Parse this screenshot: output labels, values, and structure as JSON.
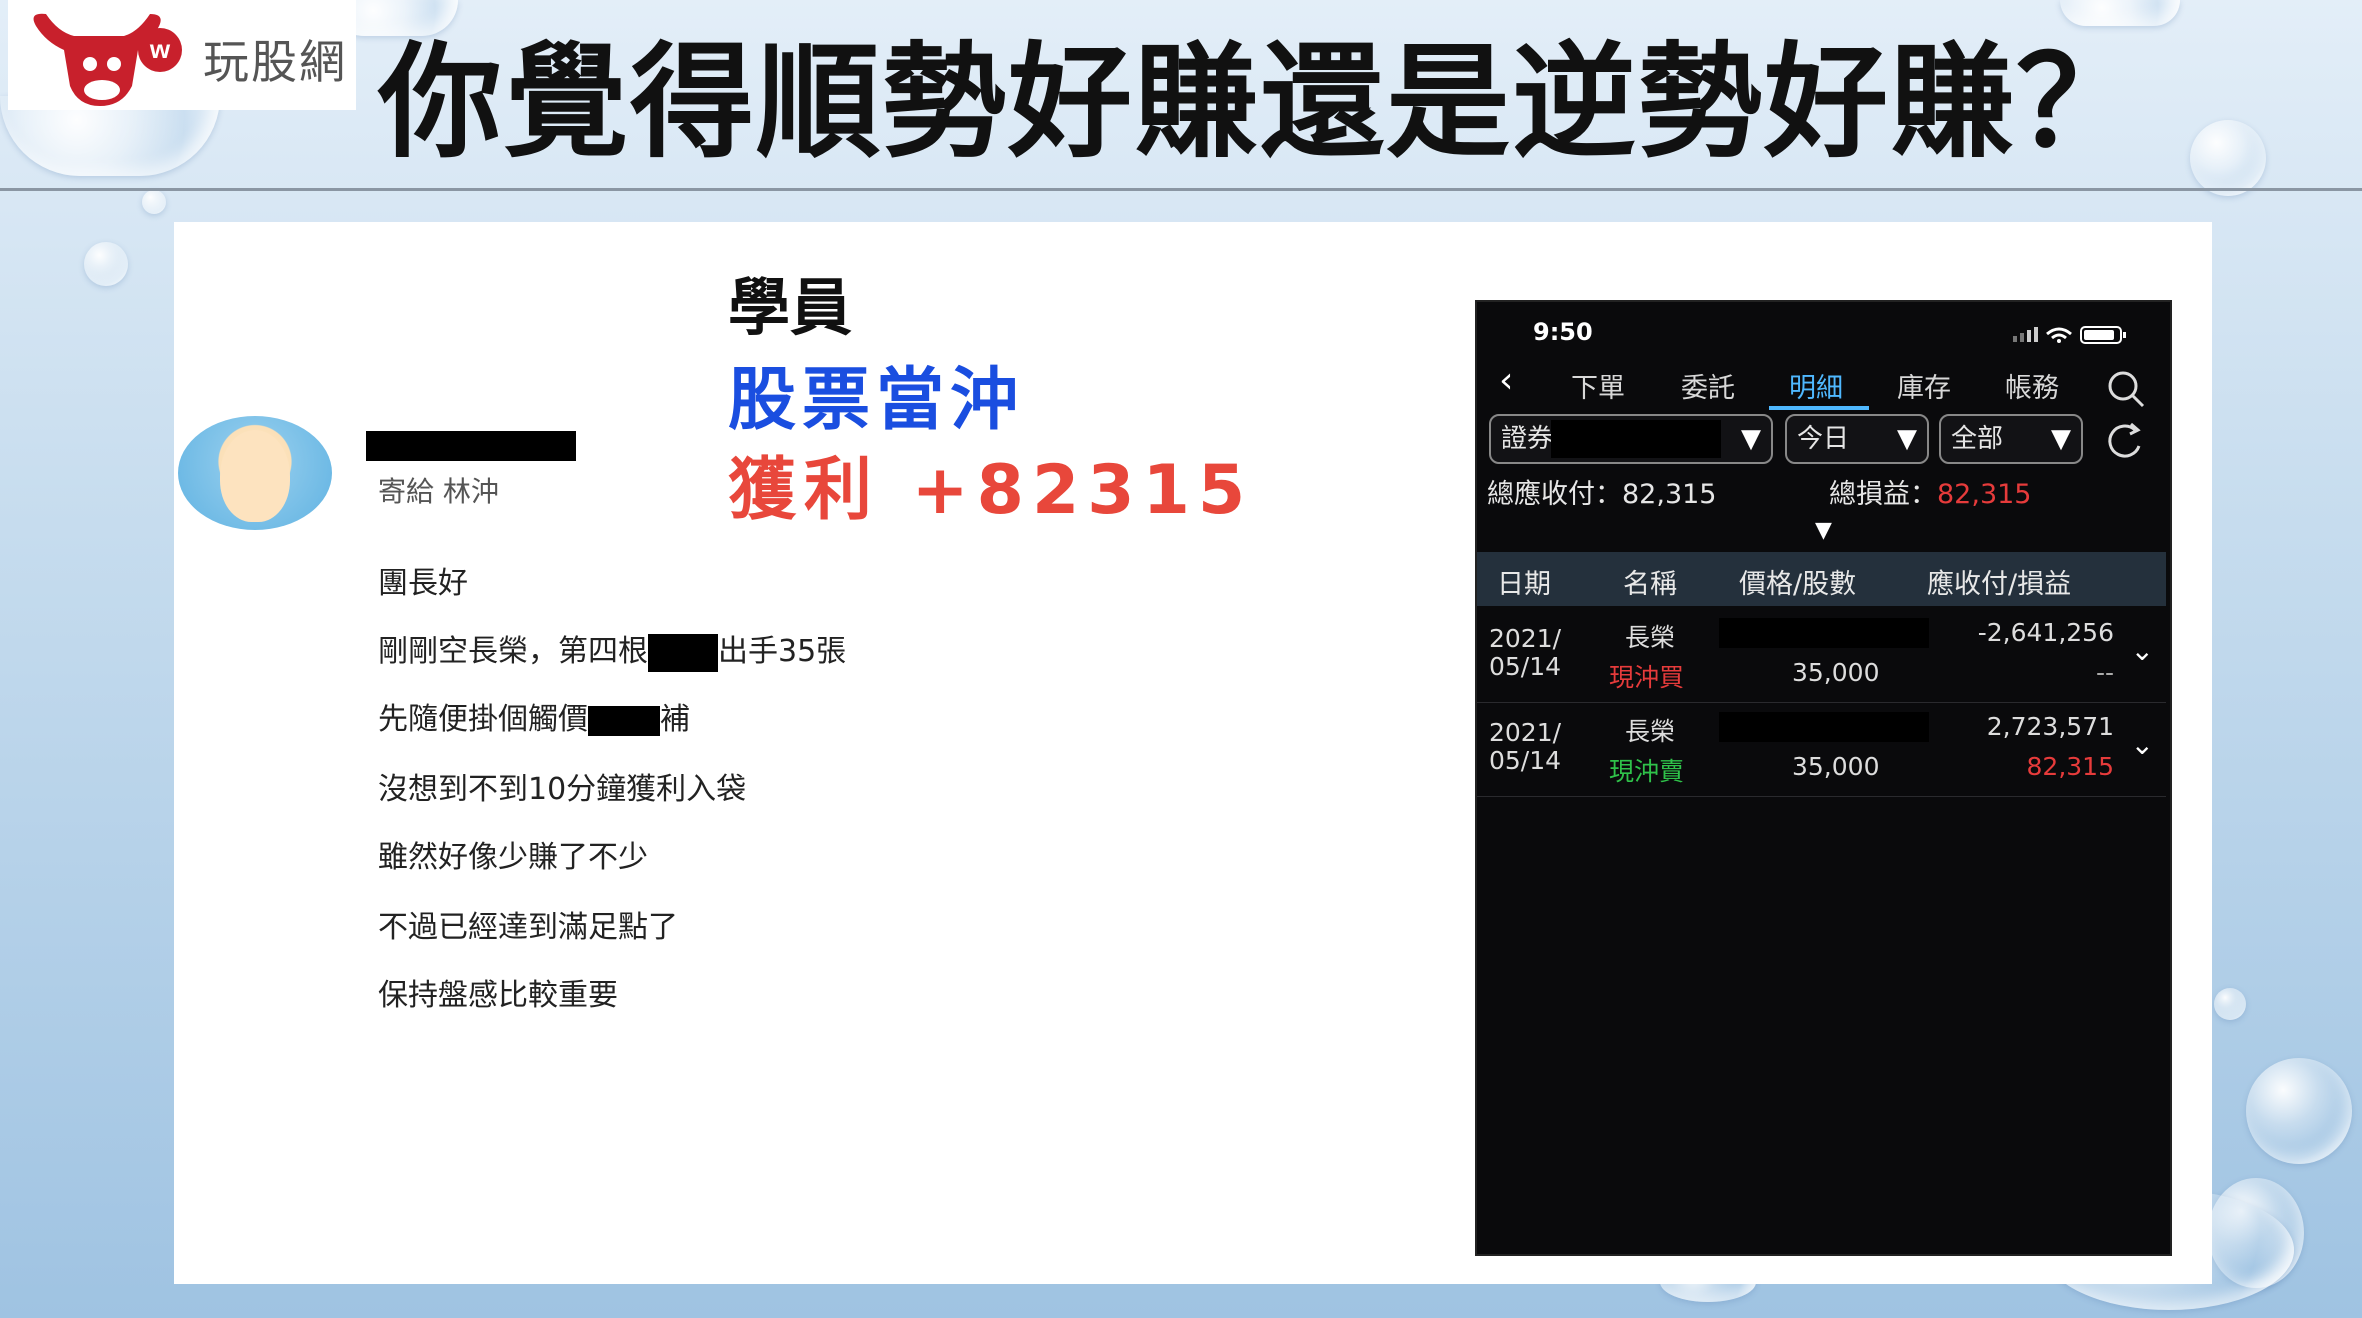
{
  "logo": {
    "brand": "玩股網",
    "mark": "w"
  },
  "title": "你覺得順勢好賺還是逆勢好賺？",
  "post": {
    "to_line": "寄給 林沖",
    "label1": "學員",
    "label2": "股票當沖",
    "label3": "獲利 +82315",
    "messages": {
      "m1": "團長好",
      "m2a": "剛剛空長榮，第四根",
      "m2b": "出手35張",
      "m3a": "先隨便掛個觸價",
      "m3b": "補",
      "m4": "沒想到不到10分鐘獲利入袋",
      "m5": "雖然好像少賺了不少",
      "m6": "不過已經達到滿足點了",
      "m7": "保持盤感比較重要"
    }
  },
  "phone": {
    "time": "9:50",
    "tabs": {
      "t1": "下單",
      "t2": "委託",
      "t3": "明細",
      "t4": "庫存",
      "t5": "帳務"
    },
    "filters": {
      "account": "證券",
      "period": "今日",
      "scope": "全部"
    },
    "summary": {
      "payable_label": "總應收付：",
      "payable_value": "82,315",
      "pnl_label": "總損益：",
      "pnl_value": "82,315"
    },
    "columns": {
      "c1": "日期",
      "c2": "名稱",
      "c3": "價格/股數",
      "c4": "應收付/損益"
    },
    "rows": [
      {
        "date1": "2021/",
        "date2": "05/14",
        "name": "長榮",
        "type": "現沖買",
        "shares": "35,000",
        "amount": "-2,641,256",
        "pnl": "--"
      },
      {
        "date1": "2021/",
        "date2": "05/14",
        "name": "長榮",
        "type": "現沖賣",
        "shares": "35,000",
        "amount": "2,723,571",
        "pnl": "82,315"
      }
    ],
    "colors": {
      "active_tab": "#4fb8ff",
      "profit": "#e63b3b",
      "buy_type": "#e63b3b",
      "sell_type": "#2fc24a"
    }
  }
}
